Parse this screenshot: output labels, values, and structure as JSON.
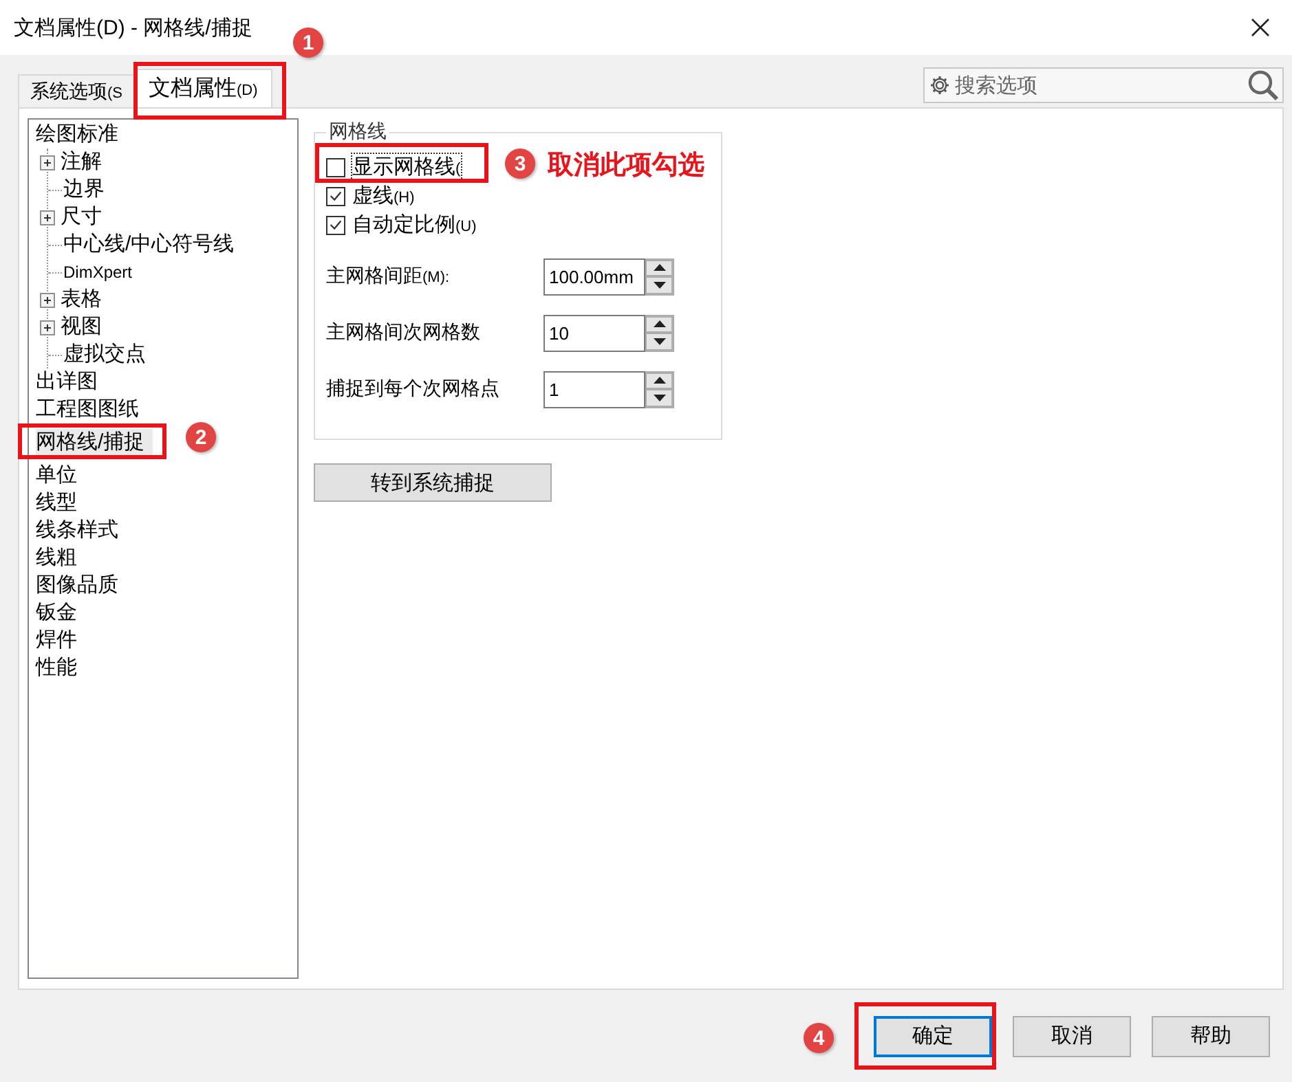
{
  "window": {
    "title": "文档属性(D) - 网格线/捕捉"
  },
  "tabs": [
    {
      "label": "系统选项",
      "mnemonic": "(S",
      "selected": false
    },
    {
      "label": "文档属性",
      "mnemonic": "(D)",
      "selected": true
    }
  ],
  "search": {
    "placeholder": "搜索选项"
  },
  "tree": {
    "items": [
      {
        "label": "绘图标准",
        "selected": false,
        "children": [
          {
            "label": "注解",
            "collapsed": true
          },
          {
            "label": "边界",
            "collapsed": false
          },
          {
            "label": "尺寸",
            "collapsed": true
          },
          {
            "label": "中心线/中心符号线",
            "collapsed": false
          },
          {
            "label": "DimXpert",
            "collapsed": false
          },
          {
            "label": "表格",
            "collapsed": true
          },
          {
            "label": "视图",
            "collapsed": true
          },
          {
            "label": "虚拟交点",
            "collapsed": false
          }
        ]
      },
      {
        "label": "出详图",
        "selected": false
      },
      {
        "label": "工程图图纸",
        "selected": false
      },
      {
        "label": "网格线/捕捉",
        "selected": true
      },
      {
        "label": "单位",
        "selected": false
      },
      {
        "label": "线型",
        "selected": false
      },
      {
        "label": "线条样式",
        "selected": false
      },
      {
        "label": "线粗",
        "selected": false
      },
      {
        "label": "图像品质",
        "selected": false
      },
      {
        "label": "钣金",
        "selected": false
      },
      {
        "label": "焊件",
        "selected": false
      },
      {
        "label": "性能",
        "selected": false
      }
    ]
  },
  "grid_group": {
    "title": "网格线",
    "checkboxes": [
      {
        "label": "显示网格线",
        "mnemonic": "(",
        "checked": false,
        "focused": true
      },
      {
        "label": "虚线",
        "mnemonic": "(H)",
        "checked": true,
        "focused": false
      },
      {
        "label": "自动定比例",
        "mnemonic": "(U)",
        "checked": true,
        "focused": false
      }
    ],
    "spinners": [
      {
        "label": "主网格间距",
        "mnemonic": "(M):",
        "value": "100.00mm"
      },
      {
        "label": "主网格间次网格数",
        "value": "10"
      },
      {
        "label": "捕捉到每个次网格点",
        "value": "1"
      }
    ]
  },
  "system_snap_button": "转到系统捕捉",
  "footer_buttons": [
    {
      "label": "确定",
      "default": true
    },
    {
      "label": "取消",
      "default": false
    },
    {
      "label": "帮助",
      "default": false
    }
  ],
  "annotations": {
    "badges": [
      "1",
      "2",
      "3",
      "4"
    ],
    "note": "取消此项勾选"
  }
}
